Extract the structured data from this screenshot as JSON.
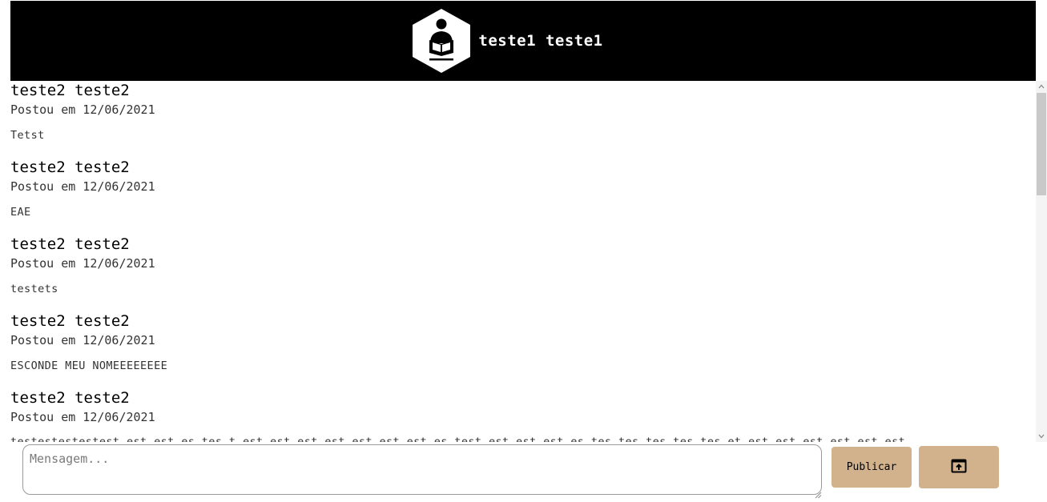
{
  "header": {
    "user_name": "teste1 teste1",
    "logo_icon": "reader-hexagon-logo-icon"
  },
  "feed": {
    "posts": [
      {
        "author": "teste2 teste2",
        "date": "Postou em 12/06/2021",
        "text": "Tetst"
      },
      {
        "author": "teste2 teste2",
        "date": "Postou em 12/06/2021",
        "text": "EAE"
      },
      {
        "author": "teste2 teste2",
        "date": "Postou em 12/06/2021",
        "text": "testets"
      },
      {
        "author": "teste2 teste2",
        "date": "Postou em 12/06/2021",
        "text": "ESCONDE MEU NOMEEEEEEEE"
      },
      {
        "author": "teste2 teste2",
        "date": "Postou em 12/06/2021",
        "text": "testestestestest est est es tes t est est est est est est est es test est est est es tes tes tes tes tes et est est est est est est"
      }
    ]
  },
  "composer": {
    "placeholder": "Mensagem...",
    "publish_label": "Publicar",
    "upload_icon": "upload-window-icon"
  },
  "colors": {
    "header_bg": "#000000",
    "button_bg": "#d1b28d"
  }
}
